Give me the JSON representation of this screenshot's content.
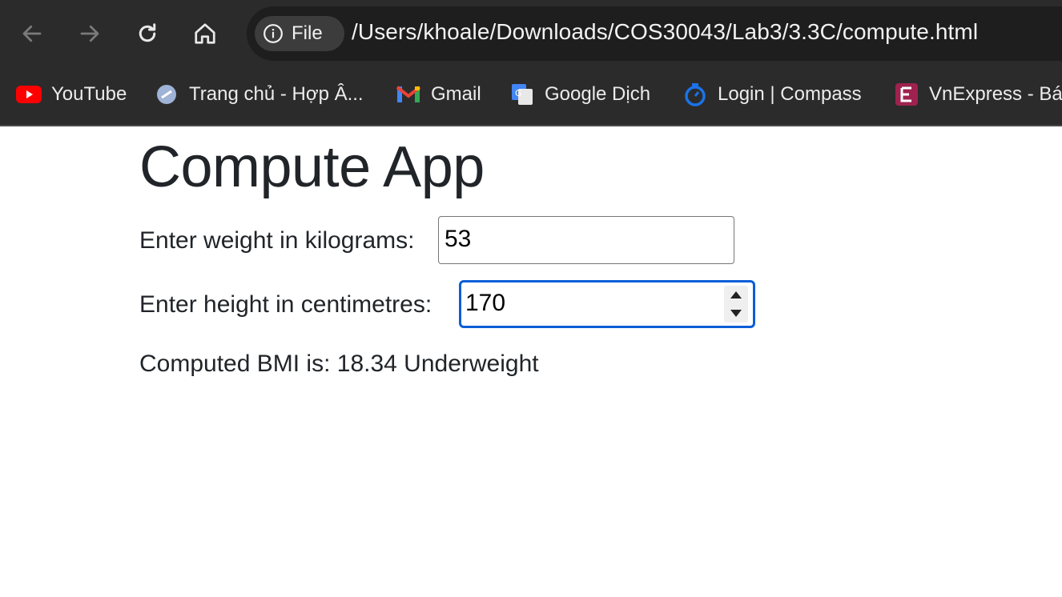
{
  "browser": {
    "url_scheme_label": "File",
    "url": "/Users/khoale/Downloads/COS30043/Lab3/3.3C/compute.html",
    "bookmarks": [
      {
        "label": "YouTube",
        "icon": "youtube-icon"
      },
      {
        "label": "Trang chủ - Hợp Â...",
        "icon": "globe-icon"
      },
      {
        "label": "Gmail",
        "icon": "gmail-icon"
      },
      {
        "label": "Google Dịch",
        "icon": "translate-icon"
      },
      {
        "label": "Login | Compass",
        "icon": "compass-icon"
      },
      {
        "label": "VnExpress - Bá",
        "icon": "vnexpress-icon"
      }
    ]
  },
  "app": {
    "title": "Compute App",
    "weight": {
      "label": "Enter weight in kilograms:",
      "value": "53"
    },
    "height": {
      "label": "Enter height in centimetres:",
      "value": "170"
    },
    "result": "Computed BMI is: 18.34 Underweight"
  },
  "colors": {
    "focus_ring": "#0b5ed7",
    "toolbar": "#2b2b2c",
    "text": "#212529"
  }
}
